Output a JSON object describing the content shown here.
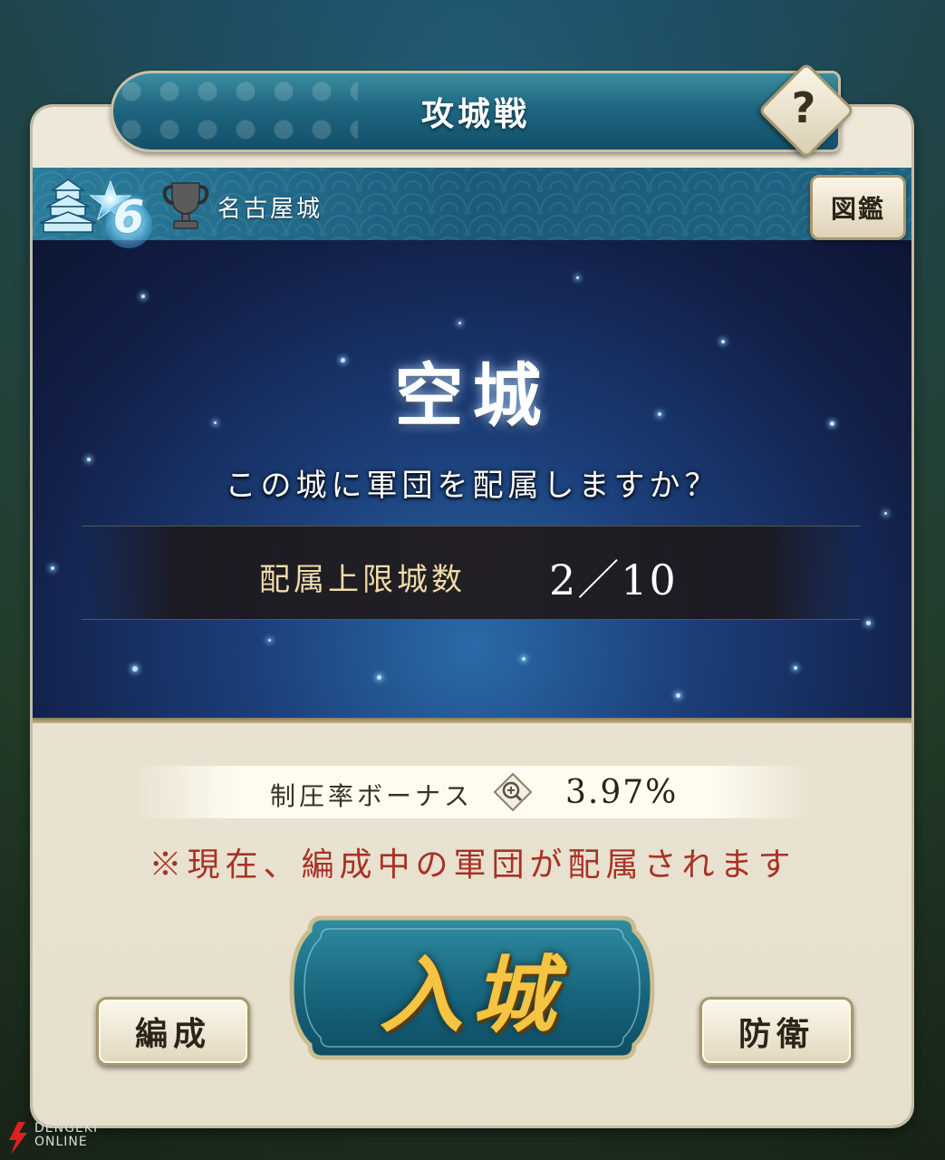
{
  "dialog": {
    "title": "攻城戦",
    "help_label": "?"
  },
  "castle": {
    "grade": "6",
    "name": "名古屋城",
    "zukan_button": "図鑑"
  },
  "status": {
    "heading": "空城",
    "question": "この城に軍団を配属しますか？",
    "limit_label": "配属上限城数",
    "limit_value": "2／10"
  },
  "bonus": {
    "label": "制圧率ボーナス",
    "value": "3.97%"
  },
  "notice": "※現在、編成中の軍団が配属されます",
  "buttons": {
    "formation": "編成",
    "enter": "入城",
    "defense": "防衛"
  },
  "watermark": {
    "line1": "DENGEKI",
    "line2": "ONLINE"
  },
  "colors": {
    "banner_teal": "#1f6680",
    "card_cream": "#eee8d9",
    "notice_red": "#a83224",
    "enter_gold": "#f4c442"
  }
}
